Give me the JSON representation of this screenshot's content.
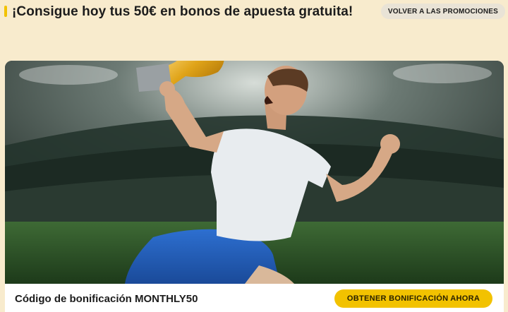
{
  "header": {
    "title": "¡Consigue hoy tus 50€ en bonos de apuesta gratuita!",
    "back_button_label": "VOLVER A LAS PROMOCIONES"
  },
  "hero": {
    "image_subject": "football-player-celebrating-with-trophy"
  },
  "footer": {
    "bonus_code_label": "Código de bonificación MONTHLY50",
    "cta_label": "OBTENER BONIFICACIÓN AHORA"
  },
  "colors": {
    "page_background": "#f8ebcd",
    "accent": "#f2c200",
    "text": "#1c1c1c"
  }
}
